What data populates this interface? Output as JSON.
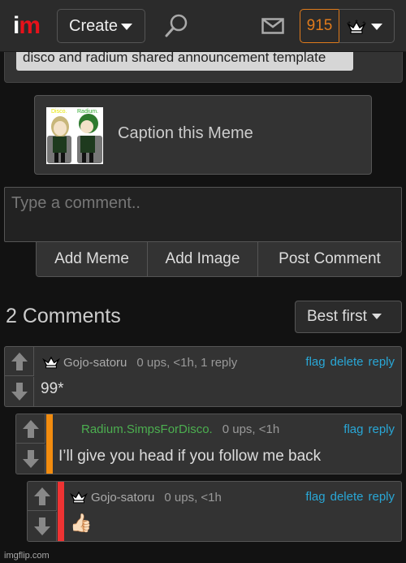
{
  "nav": {
    "logo_i": "i",
    "logo_m": "m",
    "create_label": "Create",
    "points": "915",
    "icons": [
      "search-icon",
      "mail-icon",
      "crown-icon",
      "chevron-down-icon"
    ]
  },
  "template": {
    "tag": "disco and radium shared announcement template"
  },
  "caption": {
    "label": "Caption this Meme",
    "thumb_labels": [
      "Disco.",
      "Radium."
    ]
  },
  "composer": {
    "placeholder": "Type a comment..",
    "buttons": [
      "Add Meme",
      "Add Image",
      "Post Comment"
    ]
  },
  "comments_header": {
    "count_label": "2 Comments",
    "sort_label": "Best first"
  },
  "comments": [
    {
      "user": "Gojo-satoru",
      "meta": "0 ups, <1h, 1 reply",
      "actions": [
        "flag",
        "delete",
        "reply"
      ],
      "body": "99*",
      "accent": null
    },
    {
      "user": "Radium.SimpsForDisco.",
      "meta": "0 ups, <1h",
      "actions": [
        "flag",
        "reply"
      ],
      "body": "I’ll give you head if you follow me back",
      "accent": "#f28c0f"
    },
    {
      "user": "Gojo-satoru",
      "meta": "0 ups, <1h",
      "actions": [
        "flag",
        "delete",
        "reply"
      ],
      "body": "👍🏻",
      "accent": "#ee3333"
    }
  ],
  "colors": {
    "brand_red": "#e7111a",
    "points_orange": "#e07b1c",
    "link_blue": "#29a7d6",
    "username_green": "#4caf50"
  },
  "watermark": "imgflip.com"
}
